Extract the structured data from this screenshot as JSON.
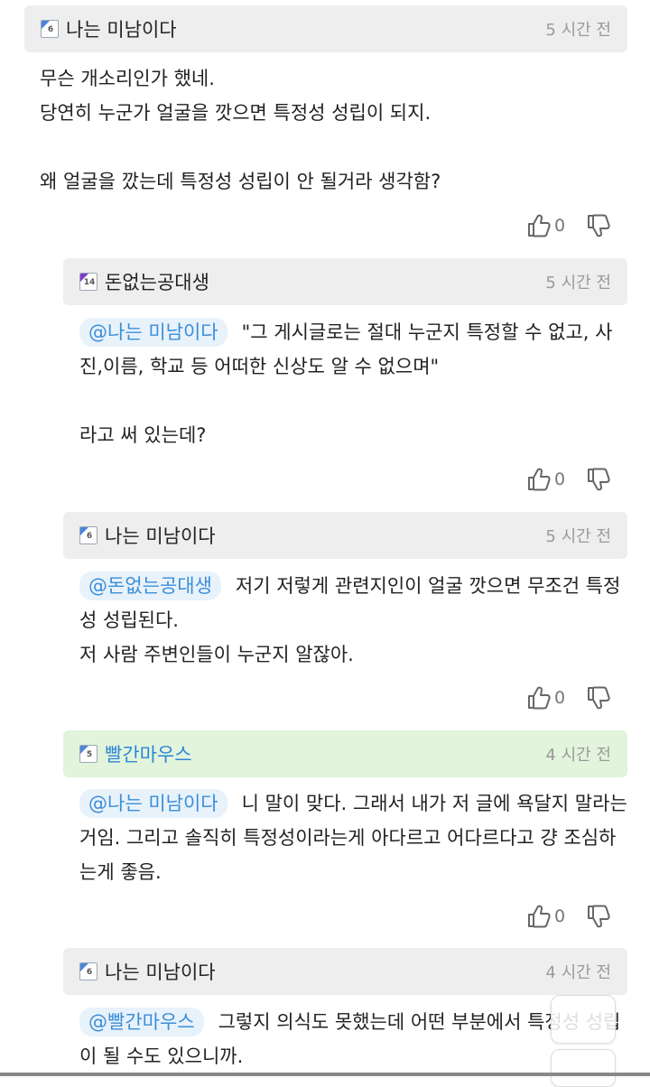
{
  "comments": [
    {
      "level": "6",
      "level_color": "#4a86d9",
      "nickname": "나는 미남이다",
      "time": "5 시간 전",
      "mention": "",
      "text": "무슨 개소리인가 했네.\n당연히 누군가 얼굴을 깟으면 특정성 성립이 되지.\n\n왜 얼굴을 깠는데 특정성 성립이 안 될거라 생각함?",
      "likes": "0"
    },
    {
      "level": "14",
      "level_color": "#7a3fc9",
      "nickname": "돈없는공대생",
      "time": "5 시간 전",
      "mention": "@나는 미남이다",
      "text": "\"그 게시글로는 절대 누군지 특정할 수 없고, 사진,이름, 학교 등 어떠한 신상도 알 수 없으며\"\n\n라고 써 있는데?",
      "likes": "0"
    },
    {
      "level": "6",
      "level_color": "#4a86d9",
      "nickname": "나는 미남이다",
      "time": "5 시간 전",
      "mention": "@돈없는공대생",
      "text": "저기 저렇게 관련지인이 얼굴 깟으면 무조건 특정성 성립된다.\n저 사람 주변인들이 누군지 알잖아.",
      "likes": "0"
    },
    {
      "level": "5",
      "level_color": "#4a86d9",
      "nickname": "빨간마우스",
      "time": "4 시간 전",
      "mention": "@나는 미남이다",
      "text": "니 말이 맞다. 그래서 내가 저 글에 욕달지 말라는거임. 그리고 솔직히 특정성이라는게 아다르고 어다르다고 걍 조심하는게 좋음.",
      "likes": "0"
    },
    {
      "level": "6",
      "level_color": "#4a86d9",
      "nickname": "나는 미남이다",
      "time": "4 시간 전",
      "mention": "@빨간마우스",
      "text": "그렇지 의식도 못했는데 어떤 부분에서 특정성 성립이 될 수도 있으니까.",
      "likes": ""
    }
  ],
  "icons": {
    "like": "thumbs-up-icon",
    "dislike": "thumbs-down-icon"
  },
  "colors": {
    "header_bg": "#eeeeee",
    "highlight_header_bg": "#e2f4dc",
    "mention_text": "#3b8ed8",
    "mention_bg": "#e8f2fb",
    "highlight_nick": "#2e86d6"
  }
}
